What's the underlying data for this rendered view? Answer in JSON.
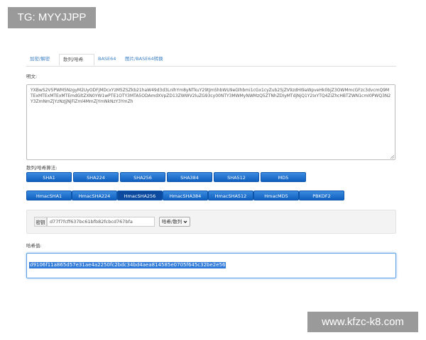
{
  "watermarks": {
    "top": "TG: MYYJJPP",
    "bottom": "www.kfzc-k8.com"
  },
  "tabs": [
    {
      "label": "加密/解密",
      "active": false
    },
    {
      "label": "散列/哈希",
      "active": true
    },
    {
      "label": "BASE64",
      "active": false
    },
    {
      "label": "图片/BASE64转换",
      "active": false
    }
  ],
  "plaintext": {
    "label": "明文:",
    "value": "YXBwS2V5PWM5NzgyM2UyODFjMDcxYzM5ZSZkb21haW49d3d3LnlhYm8yNTkuY29tJm5hbWU9eGlhbmi1cGx1cyZub25jZV9zdHI9aWpveHk0bjZ3OWMmcGFzc3dvcmQ9MTExMTExMTExMTEmdGltZXN0YW1wPTE1OTY3MTA5ODAmdXVpZD13ZWWV2luZG93cy00NTY3MWMyNWMzQ5ZTNhZDIyMTdjNjQ1Y2IxYTQ4ZiZhcHBTZWN1cmI0PWQ3N2Y3ZmNmZjYzNzJjNjFiZml4MmZjYmNkNzY3YmZh"
  },
  "algorithm": {
    "label": "散列/哈希算法:",
    "row1": [
      "SHA1",
      "SHA224",
      "SHA256",
      "SHA384",
      "SHA512",
      "MD5"
    ],
    "row2": [
      "HmacSHA1",
      "HmacSHA224",
      "HmacSHA256",
      "HmacSHA384",
      "HmacSHA512",
      "HmacMD5",
      "PBKDF2"
    ],
    "active": "HmacSHA256"
  },
  "key": {
    "label": "密钥",
    "value": "d77f7fcff637bc61bfb82fcbcd767bfa",
    "action": "哈希/散列"
  },
  "result": {
    "label": "哈希值:",
    "value": "d9106f11a865d57e31ae4a2250fc2bdc34bd4aea814585e0705f645c32be2e56"
  },
  "colors": {
    "button": "#1b6fd0",
    "button_active": "#0c4aa0",
    "link": "#3a7fc4",
    "selection": "#2f7ad9"
  }
}
